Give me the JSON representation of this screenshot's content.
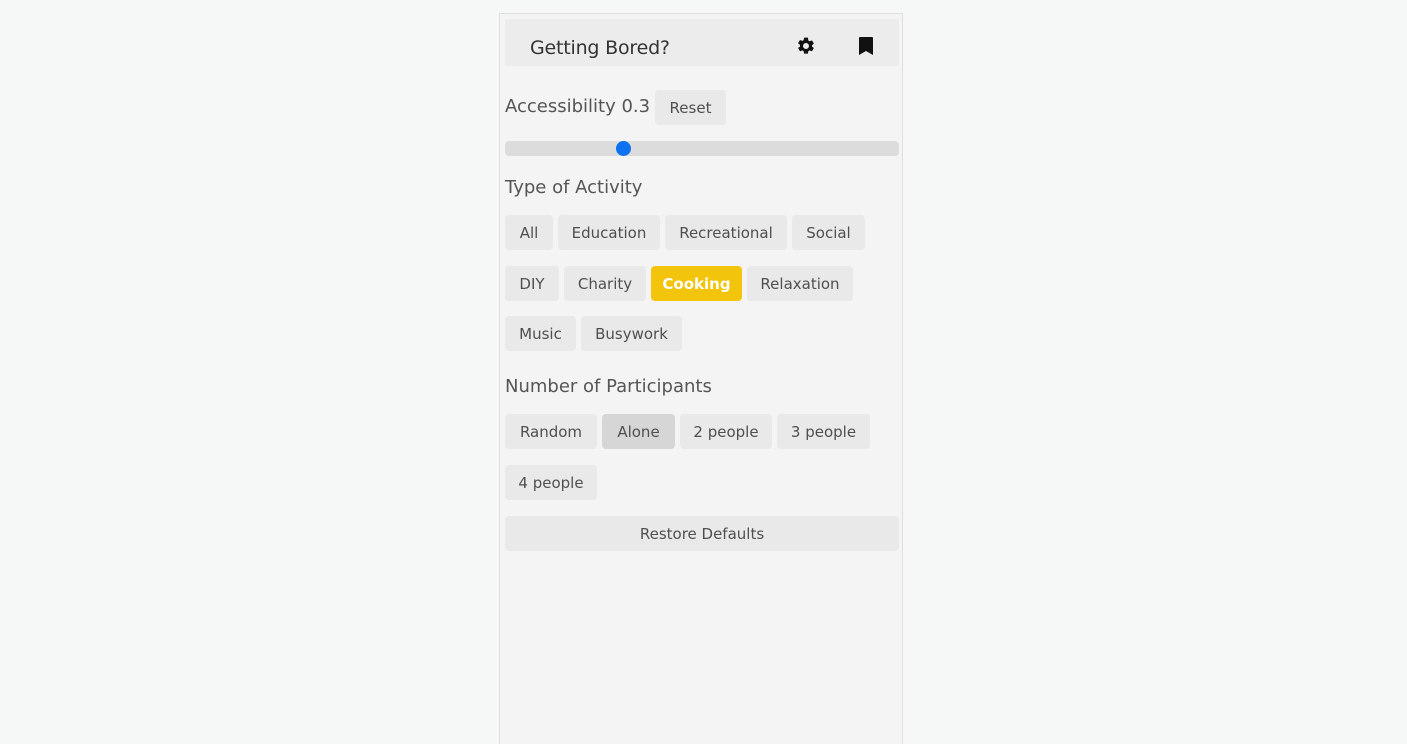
{
  "header": {
    "title": "Getting Bored?",
    "settings_icon": "gear-icon",
    "bookmark_icon": "bookmark-icon"
  },
  "accessibility": {
    "label": "Accessibility 0.3",
    "value": 0.3,
    "reset_label": "Reset",
    "thumb_color": "#0d72f0"
  },
  "activity_type": {
    "label": "Type of Activity",
    "options": [
      "All",
      "Education",
      "Recreational",
      "Social",
      "DIY",
      "Charity",
      "Cooking",
      "Relaxation",
      "Music",
      "Busywork"
    ],
    "selected": "Cooking",
    "selected_color": "#f2c40b"
  },
  "participants": {
    "label": "Number of Participants",
    "options": [
      "Random",
      "Alone",
      "2 people",
      "3 people",
      "4 people"
    ],
    "selected": "Alone"
  },
  "restore_label": "Restore Defaults"
}
